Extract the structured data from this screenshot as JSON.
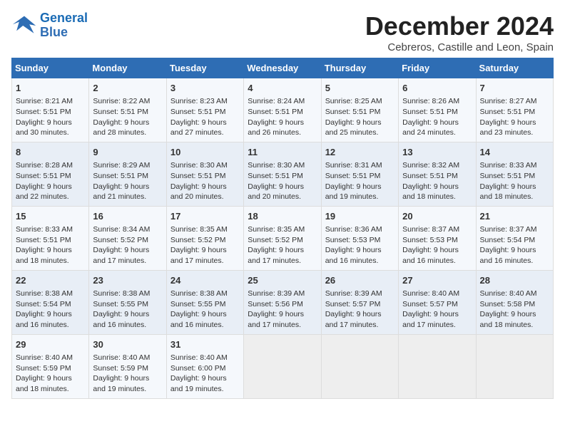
{
  "header": {
    "logo_line1": "General",
    "logo_line2": "Blue",
    "title": "December 2024",
    "subtitle": "Cebreros, Castille and Leon, Spain"
  },
  "columns": [
    "Sunday",
    "Monday",
    "Tuesday",
    "Wednesday",
    "Thursday",
    "Friday",
    "Saturday"
  ],
  "weeks": [
    [
      {
        "day": "1",
        "sunrise": "Sunrise: 8:21 AM",
        "sunset": "Sunset: 5:51 PM",
        "daylight": "Daylight: 9 hours and 30 minutes."
      },
      {
        "day": "2",
        "sunrise": "Sunrise: 8:22 AM",
        "sunset": "Sunset: 5:51 PM",
        "daylight": "Daylight: 9 hours and 28 minutes."
      },
      {
        "day": "3",
        "sunrise": "Sunrise: 8:23 AM",
        "sunset": "Sunset: 5:51 PM",
        "daylight": "Daylight: 9 hours and 27 minutes."
      },
      {
        "day": "4",
        "sunrise": "Sunrise: 8:24 AM",
        "sunset": "Sunset: 5:51 PM",
        "daylight": "Daylight: 9 hours and 26 minutes."
      },
      {
        "day": "5",
        "sunrise": "Sunrise: 8:25 AM",
        "sunset": "Sunset: 5:51 PM",
        "daylight": "Daylight: 9 hours and 25 minutes."
      },
      {
        "day": "6",
        "sunrise": "Sunrise: 8:26 AM",
        "sunset": "Sunset: 5:51 PM",
        "daylight": "Daylight: 9 hours and 24 minutes."
      },
      {
        "day": "7",
        "sunrise": "Sunrise: 8:27 AM",
        "sunset": "Sunset: 5:51 PM",
        "daylight": "Daylight: 9 hours and 23 minutes."
      }
    ],
    [
      {
        "day": "8",
        "sunrise": "Sunrise: 8:28 AM",
        "sunset": "Sunset: 5:51 PM",
        "daylight": "Daylight: 9 hours and 22 minutes."
      },
      {
        "day": "9",
        "sunrise": "Sunrise: 8:29 AM",
        "sunset": "Sunset: 5:51 PM",
        "daylight": "Daylight: 9 hours and 21 minutes."
      },
      {
        "day": "10",
        "sunrise": "Sunrise: 8:30 AM",
        "sunset": "Sunset: 5:51 PM",
        "daylight": "Daylight: 9 hours and 20 minutes."
      },
      {
        "day": "11",
        "sunrise": "Sunrise: 8:30 AM",
        "sunset": "Sunset: 5:51 PM",
        "daylight": "Daylight: 9 hours and 20 minutes."
      },
      {
        "day": "12",
        "sunrise": "Sunrise: 8:31 AM",
        "sunset": "Sunset: 5:51 PM",
        "daylight": "Daylight: 9 hours and 19 minutes."
      },
      {
        "day": "13",
        "sunrise": "Sunrise: 8:32 AM",
        "sunset": "Sunset: 5:51 PM",
        "daylight": "Daylight: 9 hours and 18 minutes."
      },
      {
        "day": "14",
        "sunrise": "Sunrise: 8:33 AM",
        "sunset": "Sunset: 5:51 PM",
        "daylight": "Daylight: 9 hours and 18 minutes."
      }
    ],
    [
      {
        "day": "15",
        "sunrise": "Sunrise: 8:33 AM",
        "sunset": "Sunset: 5:51 PM",
        "daylight": "Daylight: 9 hours and 18 minutes."
      },
      {
        "day": "16",
        "sunrise": "Sunrise: 8:34 AM",
        "sunset": "Sunset: 5:52 PM",
        "daylight": "Daylight: 9 hours and 17 minutes."
      },
      {
        "day": "17",
        "sunrise": "Sunrise: 8:35 AM",
        "sunset": "Sunset: 5:52 PM",
        "daylight": "Daylight: 9 hours and 17 minutes."
      },
      {
        "day": "18",
        "sunrise": "Sunrise: 8:35 AM",
        "sunset": "Sunset: 5:52 PM",
        "daylight": "Daylight: 9 hours and 17 minutes."
      },
      {
        "day": "19",
        "sunrise": "Sunrise: 8:36 AM",
        "sunset": "Sunset: 5:53 PM",
        "daylight": "Daylight: 9 hours and 16 minutes."
      },
      {
        "day": "20",
        "sunrise": "Sunrise: 8:37 AM",
        "sunset": "Sunset: 5:53 PM",
        "daylight": "Daylight: 9 hours and 16 minutes."
      },
      {
        "day": "21",
        "sunrise": "Sunrise: 8:37 AM",
        "sunset": "Sunset: 5:54 PM",
        "daylight": "Daylight: 9 hours and 16 minutes."
      }
    ],
    [
      {
        "day": "22",
        "sunrise": "Sunrise: 8:38 AM",
        "sunset": "Sunset: 5:54 PM",
        "daylight": "Daylight: 9 hours and 16 minutes."
      },
      {
        "day": "23",
        "sunrise": "Sunrise: 8:38 AM",
        "sunset": "Sunset: 5:55 PM",
        "daylight": "Daylight: 9 hours and 16 minutes."
      },
      {
        "day": "24",
        "sunrise": "Sunrise: 8:38 AM",
        "sunset": "Sunset: 5:55 PM",
        "daylight": "Daylight: 9 hours and 16 minutes."
      },
      {
        "day": "25",
        "sunrise": "Sunrise: 8:39 AM",
        "sunset": "Sunset: 5:56 PM",
        "daylight": "Daylight: 9 hours and 17 minutes."
      },
      {
        "day": "26",
        "sunrise": "Sunrise: 8:39 AM",
        "sunset": "Sunset: 5:57 PM",
        "daylight": "Daylight: 9 hours and 17 minutes."
      },
      {
        "day": "27",
        "sunrise": "Sunrise: 8:40 AM",
        "sunset": "Sunset: 5:57 PM",
        "daylight": "Daylight: 9 hours and 17 minutes."
      },
      {
        "day": "28",
        "sunrise": "Sunrise: 8:40 AM",
        "sunset": "Sunset: 5:58 PM",
        "daylight": "Daylight: 9 hours and 18 minutes."
      }
    ],
    [
      {
        "day": "29",
        "sunrise": "Sunrise: 8:40 AM",
        "sunset": "Sunset: 5:59 PM",
        "daylight": "Daylight: 9 hours and 18 minutes."
      },
      {
        "day": "30",
        "sunrise": "Sunrise: 8:40 AM",
        "sunset": "Sunset: 5:59 PM",
        "daylight": "Daylight: 9 hours and 19 minutes."
      },
      {
        "day": "31",
        "sunrise": "Sunrise: 8:40 AM",
        "sunset": "Sunset: 6:00 PM",
        "daylight": "Daylight: 9 hours and 19 minutes."
      },
      null,
      null,
      null,
      null
    ]
  ]
}
